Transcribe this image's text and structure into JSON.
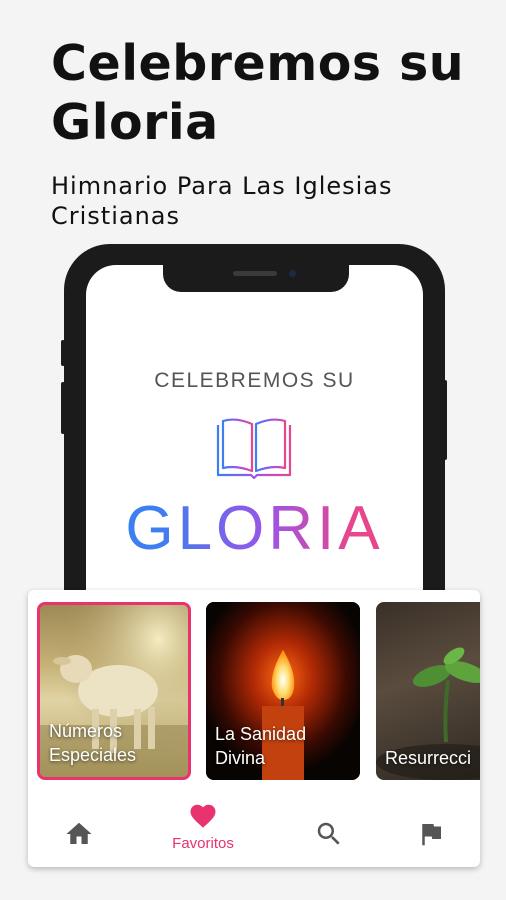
{
  "headline": "Celebremos su Gloria",
  "subtitle": "Himnario Para Las Iglesias Cristianas",
  "phone_screen": {
    "brand_top": "CELEBREMOS SU",
    "brand_main": "GLORIA",
    "book_icon": "open-book-icon"
  },
  "categories": [
    {
      "label_line1": "Números",
      "label_line2": "Especiales",
      "selected": true
    },
    {
      "label_line1": "La Sanidad",
      "label_line2": "Divina",
      "selected": false
    },
    {
      "label_line1": "",
      "label_line2": "Resurrecci",
      "selected": false
    }
  ],
  "nav": {
    "items": [
      {
        "icon": "home-icon",
        "label": ""
      },
      {
        "icon": "heart-icon",
        "label": "Favoritos",
        "active": true
      },
      {
        "icon": "search-icon",
        "label": ""
      },
      {
        "icon": "flag-icon",
        "label": ""
      }
    ]
  },
  "colors": {
    "accent": "#e8336f",
    "icon_gray": "#555555",
    "gloria_gradient_start": "#3b7ff0",
    "gloria_gradient_mid": "#9b55e8",
    "gloria_gradient_end": "#e8468c"
  }
}
